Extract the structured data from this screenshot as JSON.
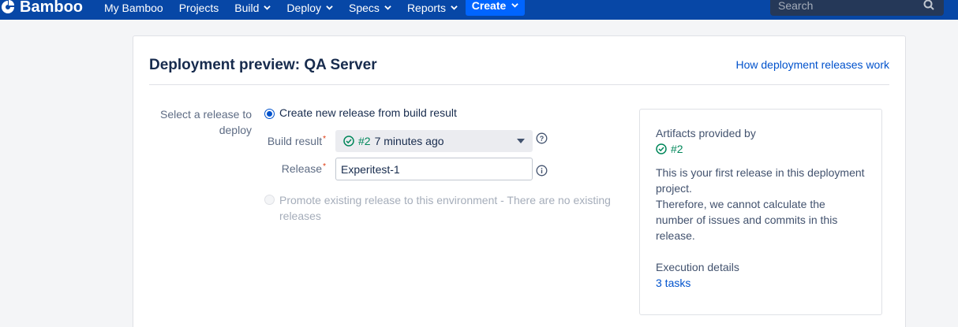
{
  "nav": {
    "logo": "Bamboo",
    "items": [
      {
        "label": "My Bamboo",
        "dropdown": false
      },
      {
        "label": "Projects",
        "dropdown": false
      },
      {
        "label": "Build",
        "dropdown": true
      },
      {
        "label": "Deploy",
        "dropdown": true
      },
      {
        "label": "Specs",
        "dropdown": true
      },
      {
        "label": "Reports",
        "dropdown": true
      }
    ],
    "create_label": "Create",
    "search_placeholder": "Search"
  },
  "page": {
    "title": "Deployment preview: QA Server",
    "help_link": "How deployment releases work"
  },
  "form": {
    "select_label": "Select a release to deploy",
    "option_new": "Create new release from build result",
    "build_result_label": "Build result",
    "build_result_number": "#2",
    "build_result_time": "7 minutes ago",
    "release_label": "Release",
    "release_value": "Experitest-1",
    "option_promote": "Promote existing release to this environment - There are no existing releases"
  },
  "info": {
    "artifacts_label": "Artifacts provided by",
    "artifact_build": "#2",
    "first_release_text": "This is your first release in this deployment project.",
    "therefore_text": "Therefore, we cannot calculate the number of issues and commits in this release.",
    "execution_label": "Execution details",
    "tasks_link": "3 tasks"
  },
  "colors": {
    "nav_bg": "#0747a6",
    "create_bg": "#0065ff",
    "success": "#00875a",
    "link": "#0052cc"
  }
}
